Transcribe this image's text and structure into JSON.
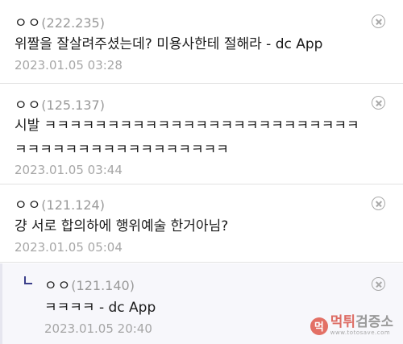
{
  "comments": [
    {
      "nick": "ㅇㅇ",
      "ip": "(222.235)",
      "lines": [
        "위짤을 잘살려주셨는데? 미용사한테 절해라 - dc App"
      ],
      "date": "2023.01.05 03:28"
    },
    {
      "nick": "ㅇㅇ",
      "ip": "(125.137)",
      "lines": [
        "시발 ㅋㅋㅋㅋㅋㅋㅋㅋㅋㅋㅋㅋㅋㅋㅋㅋㅋㅋㅋㅋㅋㅋㅋㅋㅋ",
        "ㅋㅋㅋㅋㅋㅋㅋㅋㅋㅋㅋㅋㅋㅋㅋㅋㅋ"
      ],
      "date": "2023.01.05 03:44"
    },
    {
      "nick": "ㅇㅇ",
      "ip": "(121.124)",
      "lines": [
        "걍 서로 합의하에 행위예술 한거아님?"
      ],
      "date": "2023.01.05 05:04"
    }
  ],
  "reply": {
    "nick": "ㅇㅇ",
    "ip": "(121.140)",
    "text": "ㅋㅋㅋㅋ - dc App",
    "date": "2023.01.05 20:40"
  },
  "watermark": {
    "logo_char": "먹",
    "main_red": "먹튀",
    "main_grey": "검증소",
    "sub": "www.totosave.com"
  }
}
